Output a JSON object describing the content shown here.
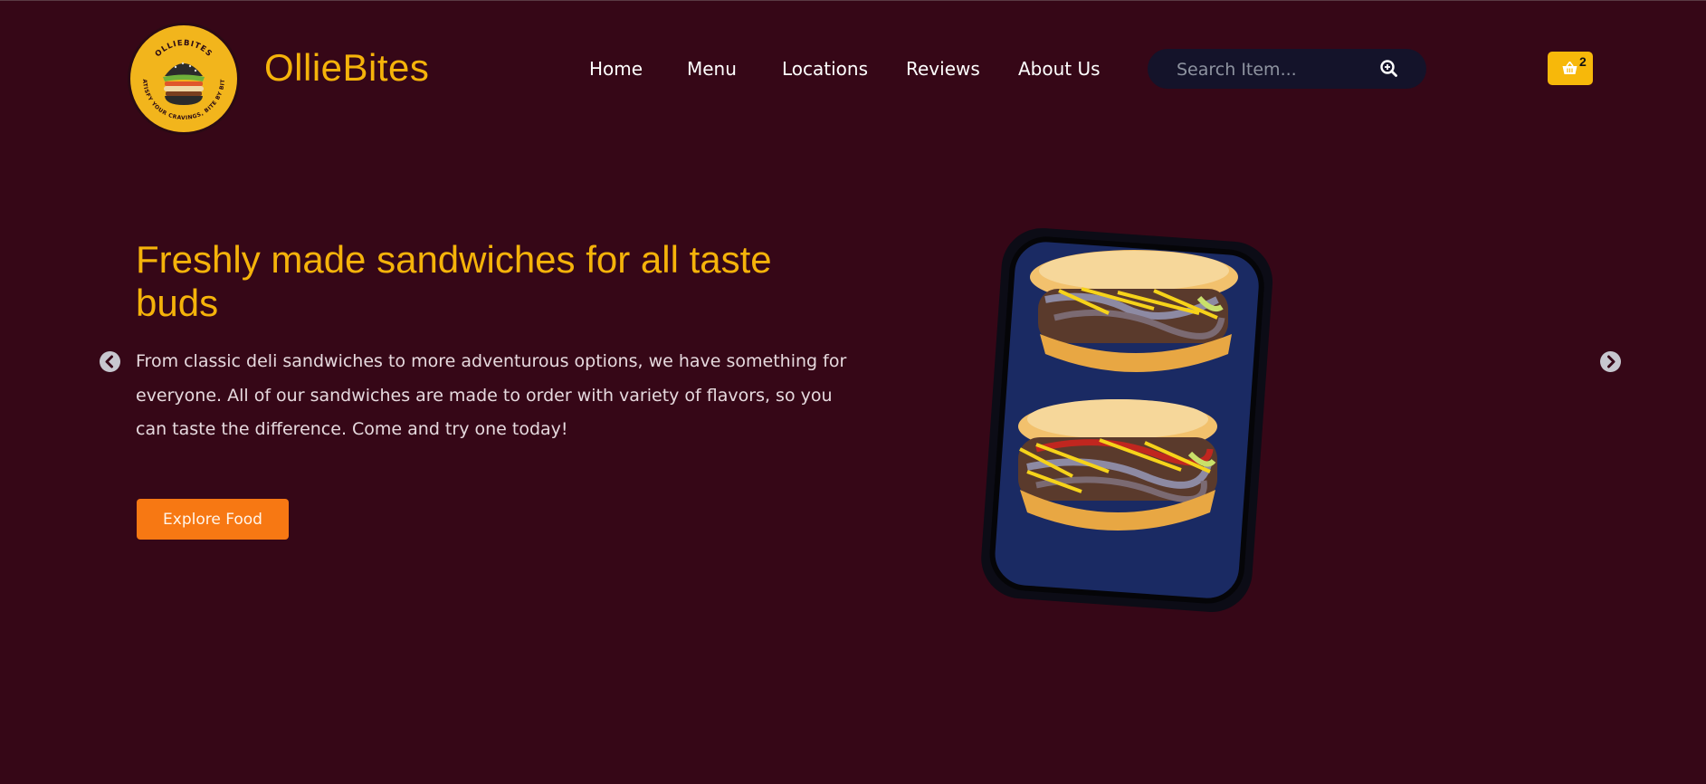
{
  "brand": {
    "name": "OllieBites",
    "logo_top_text": "OLLIEBITES",
    "logo_ring_text": "SATISFY YOUR CRAVINGS, BITE BY BITE"
  },
  "nav": {
    "items": [
      {
        "label": "Home"
      },
      {
        "label": "Menu"
      },
      {
        "label": "Locations"
      },
      {
        "label": "Reviews"
      },
      {
        "label": "About Us"
      }
    ]
  },
  "search": {
    "placeholder": "Search Item...",
    "icon": "search-icon"
  },
  "cart": {
    "icon": "basket-icon",
    "count": "2"
  },
  "hero": {
    "title": "Freshly made sandwiches for all taste buds",
    "description": "From classic deli sandwiches to more adventurous options, we have something for everyone. All of our sandwiches are made to order with variety of flavors, so you can taste the difference. Come and try one today!",
    "cta_label": "Explore Food",
    "prev_icon": "chevron-left-icon",
    "next_icon": "chevron-right-icon"
  },
  "colors": {
    "background": "#360717",
    "accent": "#f5b30a",
    "button": "#f77813",
    "search_bg": "#14132a"
  }
}
